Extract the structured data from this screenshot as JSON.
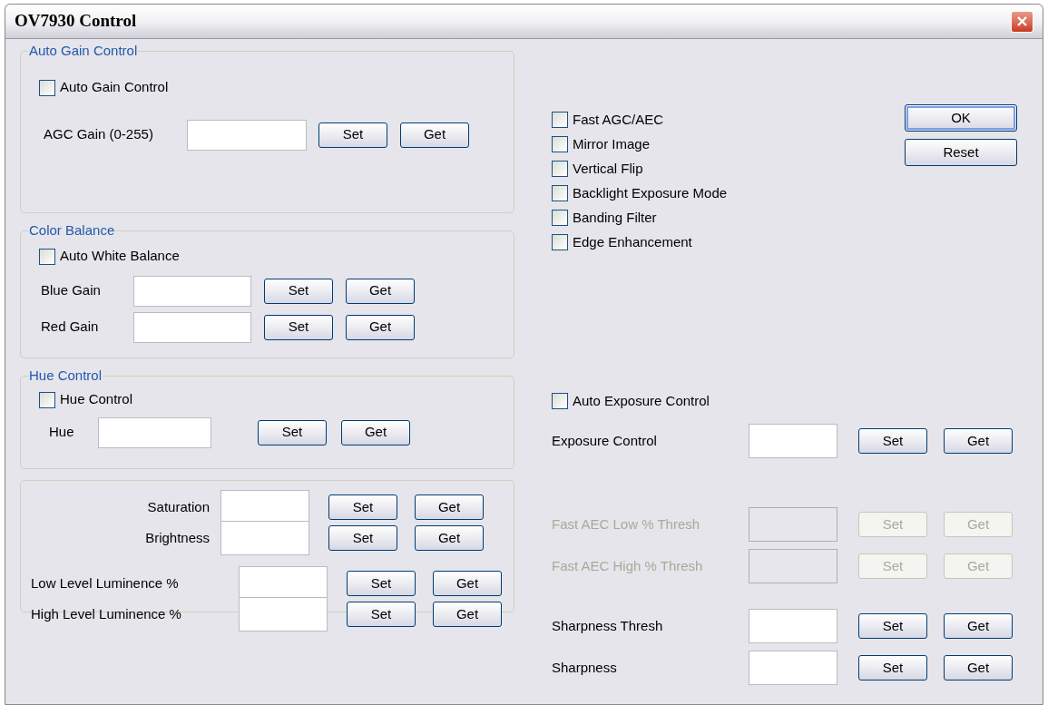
{
  "window": {
    "title": "OV7930 Control"
  },
  "groups": [
    {
      "title": "Auto Gain Control",
      "checkbox": {
        "label": "Auto Gain Control",
        "checked": false
      },
      "rows": [
        {
          "label": "AGC Gain (0-255)",
          "set": "Set",
          "get": "Get"
        }
      ]
    },
    {
      "title": "Color Balance",
      "checkbox": {
        "label": "Auto White Balance",
        "checked": false
      },
      "rows": [
        {
          "label": "Blue Gain",
          "set": "Set",
          "get": "Get"
        },
        {
          "label": "Red Gain",
          "set": "Set",
          "get": "Get"
        }
      ]
    },
    {
      "title": "Hue Control",
      "checkbox": {
        "label": "Hue Control",
        "checked": false
      },
      "rows": [
        {
          "label": "Hue",
          "set": "Set",
          "get": "Get"
        }
      ]
    },
    {
      "rows": [
        {
          "label": "Saturation",
          "set": "Set",
          "get": "Get"
        },
        {
          "label": "Brightness",
          "set": "Set",
          "get": "Get"
        },
        {
          "label": "Low Level Luminence %",
          "set": "Set",
          "get": "Get"
        },
        {
          "label": "High Level Luminence %",
          "set": "Set",
          "get": "Get"
        }
      ]
    }
  ],
  "options": [
    {
      "label": "Fast AGC/AEC",
      "checked": false
    },
    {
      "label": "Mirror Image",
      "checked": false
    },
    {
      "label": "Vertical Flip",
      "checked": false
    },
    {
      "label": "Backlight Exposure Mode",
      "checked": false
    },
    {
      "label": "Banding Filter",
      "checked": false
    },
    {
      "label": "Edge Enhancement",
      "checked": false
    }
  ],
  "buttons": [
    {
      "label": "OK",
      "default": true
    },
    {
      "label": "Reset",
      "default": false
    }
  ],
  "exposure": {
    "checkbox": {
      "label": "Auto Exposure Control",
      "checked": false
    },
    "rows": [
      {
        "label": "Exposure Control",
        "set": "Set",
        "get": "Get",
        "disabled": false
      },
      {
        "label": "Fast AEC Low % Thresh",
        "set": "Set",
        "get": "Get",
        "disabled": true
      },
      {
        "label": "Fast AEC High % Thresh",
        "set": "Set",
        "get": "Get",
        "disabled": true
      },
      {
        "label": "Sharpness Thresh",
        "set": "Set",
        "get": "Get",
        "disabled": false
      },
      {
        "label": "Sharpness",
        "set": "Set",
        "get": "Get",
        "disabled": false
      }
    ]
  }
}
